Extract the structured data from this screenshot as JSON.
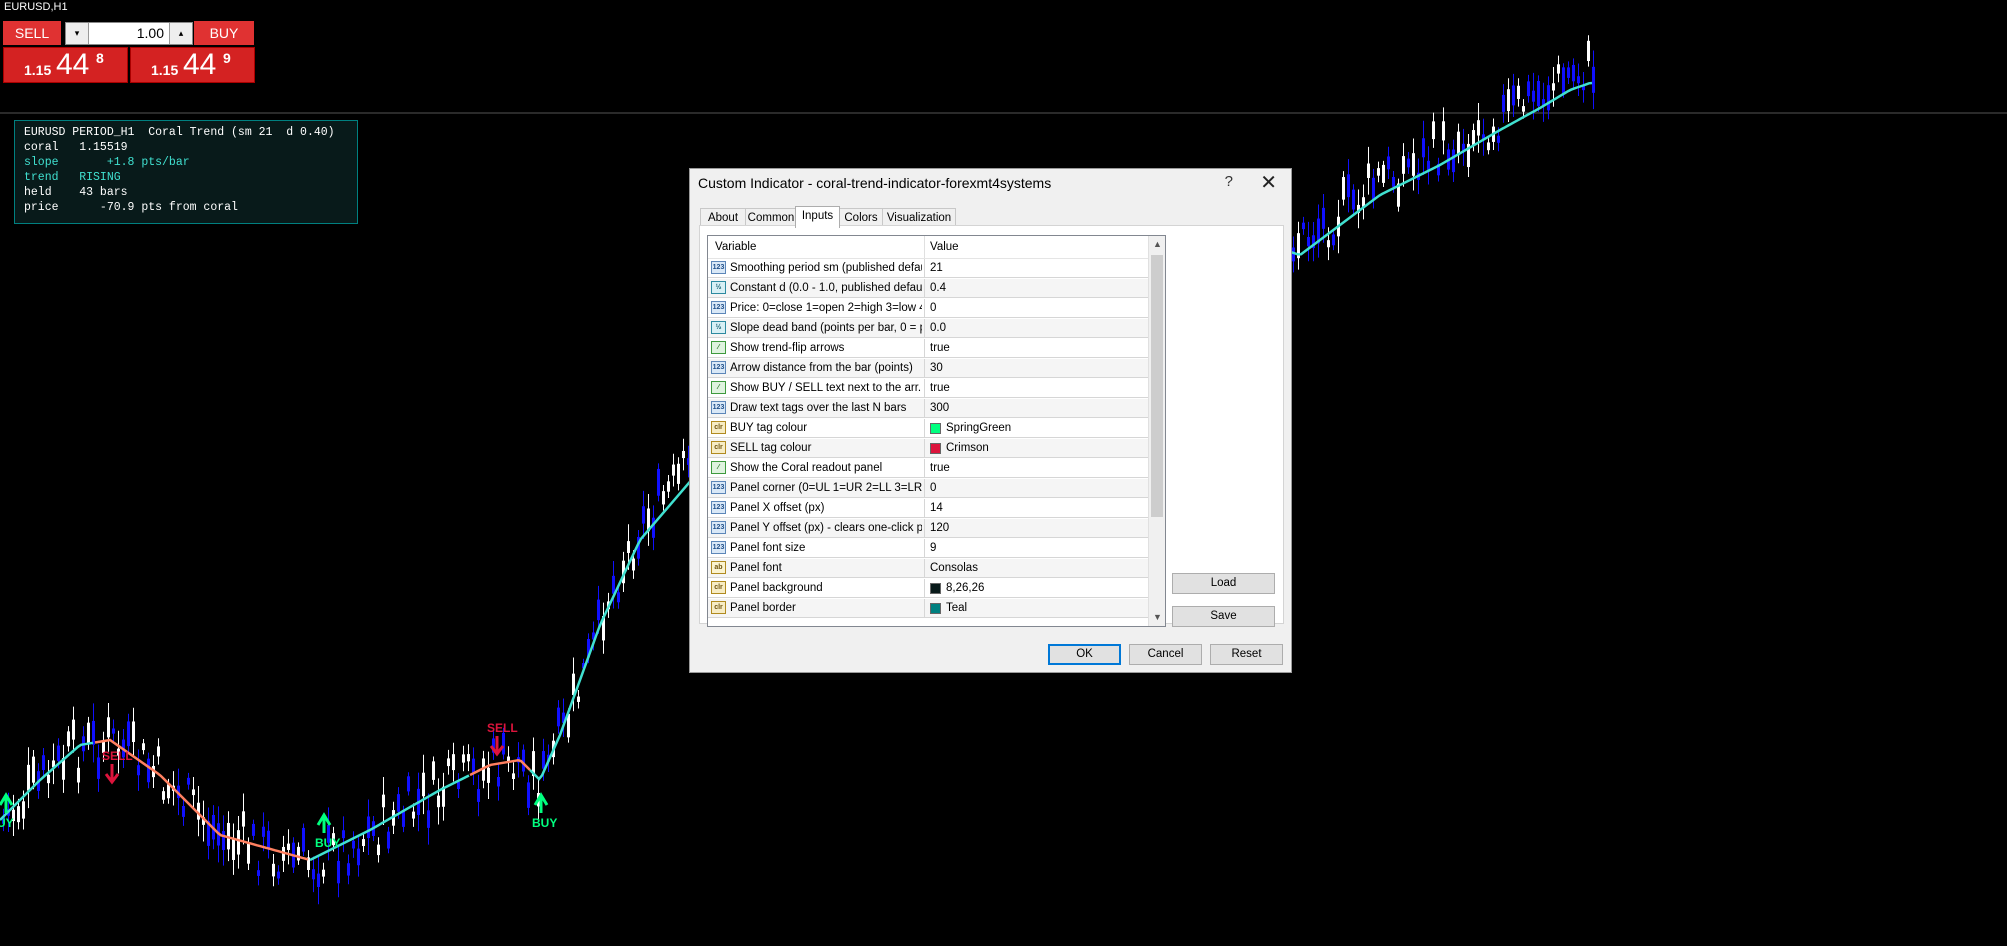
{
  "chart": {
    "title": "EURUSD,H1",
    "colors": {
      "background": "#000000",
      "bull": "#1010ff",
      "bear": "#ffffff",
      "coral_up": "#40e0d0",
      "coral_down": "#ff8060",
      "buy_tag": "#00ff7f",
      "sell_tag": "#dc143c"
    },
    "arrow_tags": [
      {
        "label": "UY",
        "type": "buy"
      },
      {
        "label": "SELL",
        "type": "sell"
      },
      {
        "label": "BUY",
        "type": "buy"
      },
      {
        "label": "SELL",
        "type": "sell"
      },
      {
        "label": "BUY",
        "type": "buy"
      }
    ]
  },
  "one_click": {
    "sell_label": "SELL",
    "buy_label": "BUY",
    "volume": "1.00",
    "sell_price": {
      "small": "1.15",
      "big": "44",
      "sup": "8"
    },
    "buy_price": {
      "small": "1.15",
      "big": "44",
      "sup": "9"
    }
  },
  "coral_panel": {
    "lines": [
      {
        "text": "EURUSD PERIOD_H1  Coral Trend (sm 21  d 0.40)",
        "color": "#ffffff"
      },
      {
        "text": "coral   1.15519",
        "color": "#ffffff"
      },
      {
        "text": "slope       +1.8 pts/bar",
        "color": "#40e0d0"
      },
      {
        "text": "trend   RISING",
        "color": "#40e0d0"
      },
      {
        "text": "held    43 bars",
        "color": "#ffffff"
      },
      {
        "text": "price      -70.9 pts from coral",
        "color": "#ffffff"
      }
    ]
  },
  "dialog": {
    "title": "Custom Indicator - coral-trend-indicator-forexmt4systems",
    "help": "?",
    "close": "✕",
    "tabs": [
      "About",
      "Common",
      "Inputs",
      "Colors",
      "Visualization"
    ],
    "active_tab": "Inputs",
    "headers": {
      "variable": "Variable",
      "value": "Value"
    },
    "rows": [
      {
        "icon": "int",
        "icon_label": "123",
        "name": "Smoothing period sm (published default...",
        "value": "21"
      },
      {
        "icon": "dbl",
        "icon_label": "½",
        "name": "Constant d (0.0 - 1.0, published default...",
        "value": "0.4"
      },
      {
        "icon": "int",
        "icon_label": "123",
        "name": "Price: 0=close 1=open 2=high 3=low 4...",
        "value": "0"
      },
      {
        "icon": "dbl",
        "icon_label": "½",
        "name": "Slope dead band (points per bar, 0 = p...",
        "value": "0.0"
      },
      {
        "icon": "bool",
        "icon_label": "⁄",
        "name": "Show trend-flip arrows",
        "value": "true"
      },
      {
        "icon": "int",
        "icon_label": "123",
        "name": "Arrow distance from the bar (points)",
        "value": "30"
      },
      {
        "icon": "bool",
        "icon_label": "⁄",
        "name": "Show BUY / SELL text next to the arr...",
        "value": "true"
      },
      {
        "icon": "int",
        "icon_label": "123",
        "name": "Draw text tags over the last N bars",
        "value": "300"
      },
      {
        "icon": "col",
        "icon_label": "clr",
        "name": "BUY tag colour",
        "value": "SpringGreen",
        "swatch": "#00ff7f"
      },
      {
        "icon": "col",
        "icon_label": "clr",
        "name": "SELL tag colour",
        "value": "Crimson",
        "swatch": "#dc143c"
      },
      {
        "icon": "bool",
        "icon_label": "⁄",
        "name": "Show the Coral readout panel",
        "value": "true"
      },
      {
        "icon": "int",
        "icon_label": "123",
        "name": "Panel corner (0=UL 1=UR 2=LL 3=LR)",
        "value": "0"
      },
      {
        "icon": "int",
        "icon_label": "123",
        "name": "Panel X offset (px)",
        "value": "14"
      },
      {
        "icon": "int",
        "icon_label": "123",
        "name": "Panel Y offset (px) - clears one-click pa...",
        "value": "120"
      },
      {
        "icon": "int",
        "icon_label": "123",
        "name": "Panel font size",
        "value": "9"
      },
      {
        "icon": "str",
        "icon_label": "ab",
        "name": "Panel font",
        "value": "Consolas"
      },
      {
        "icon": "col",
        "icon_label": "clr",
        "name": "Panel background",
        "value": "8,26,26",
        "swatch": "#081a1a"
      },
      {
        "icon": "col",
        "icon_label": "clr",
        "name": "Panel border",
        "value": "Teal",
        "swatch": "#008080"
      }
    ],
    "buttons": {
      "load": "Load",
      "save": "Save",
      "ok": "OK",
      "cancel": "Cancel",
      "reset": "Reset"
    }
  }
}
